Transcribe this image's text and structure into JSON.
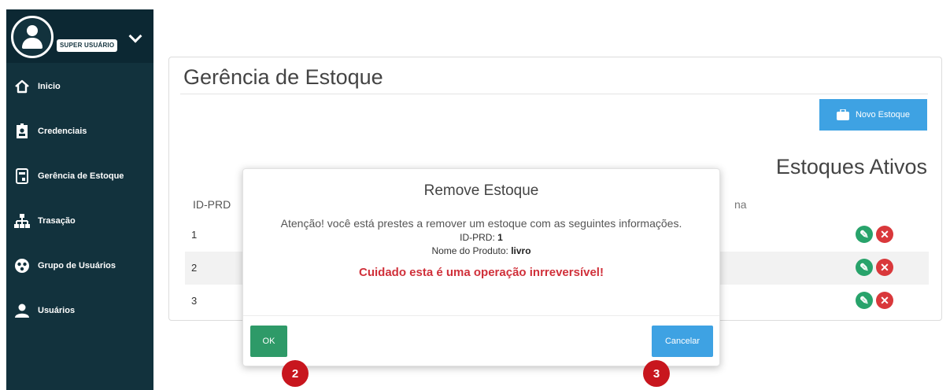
{
  "user": {
    "role": "SUPER USUÁRIO"
  },
  "sidebar": {
    "items": [
      {
        "label": "Inicio",
        "icon": "home-icon"
      },
      {
        "label": "Credenciais",
        "icon": "id-card-icon"
      },
      {
        "label": "Gerência de Estoque",
        "icon": "inventory-icon"
      },
      {
        "label": "Trasação",
        "icon": "sitemap-icon"
      },
      {
        "label": "Grupo de Usuários",
        "icon": "group-icon"
      },
      {
        "label": "Usuários",
        "icon": "user-icon"
      }
    ]
  },
  "main": {
    "title": "Gerência de Estoque",
    "new_button": "Novo Estoque",
    "section_title": "Estoques Ativos",
    "table": {
      "headers": {
        "id": "ID-PRD",
        "trail": "na"
      },
      "rows": [
        {
          "id": "1"
        },
        {
          "id": "2"
        },
        {
          "id": "3"
        }
      ]
    }
  },
  "modal": {
    "title": "Remove Estoque",
    "warning": "Atenção! você está prestes a remover um estoque com as seguintes informações.",
    "id_label": "ID-PRD:",
    "id_value": "1",
    "name_label": "Nome do Produto:",
    "name_value": "livro",
    "danger": "Cuidado esta é uma operação inrreversível!",
    "ok_label": "OK",
    "cancel_label": "Cancelar"
  },
  "markers": {
    "ok": "2",
    "cancel": "3"
  },
  "colors": {
    "sidebar": "#12323d",
    "primary": "#3ea2e3",
    "success": "#2e9a68",
    "danger": "#d0303a",
    "marker": "#c8161e"
  }
}
